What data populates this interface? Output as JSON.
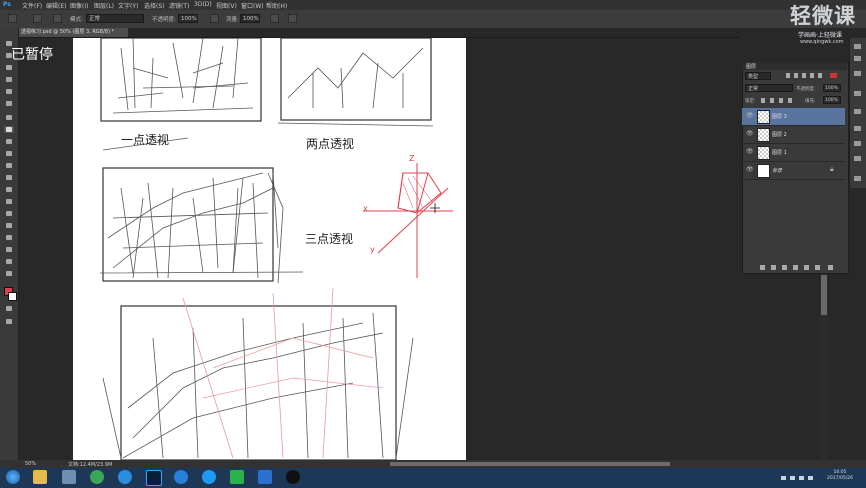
{
  "app": {
    "logo": "Ps"
  },
  "menu": [
    "文件(F)",
    "编辑(E)",
    "图像(I)",
    "图层(L)",
    "文字(Y)",
    "选择(S)",
    "滤镜(T)",
    "3D(D)",
    "视图(V)",
    "窗口(W)",
    "帮助(H)"
  ],
  "options": {
    "mode_label": "模式:",
    "mode_value": "正常",
    "opacity_label": "不透明度:",
    "opacity_value": "100%",
    "flow_label": "流量:",
    "flow_value": "100%"
  },
  "document_tab": "透视练习.psd @ 50% (图层 3, RGB/8) *",
  "overlay": {
    "paused": "已暂停"
  },
  "sketch": {
    "label_one_point": "一点透视",
    "label_two_point": "两点透视",
    "label_three_point": "三点透视",
    "axis_z": "Z",
    "axis_x": "x",
    "axis_y": "y"
  },
  "layers_panel": {
    "tab": "图层",
    "filter_label": "类型",
    "blend_mode": "正常",
    "opacity_label": "不透明度:",
    "opacity_value": "100%",
    "lock_label": "锁定:",
    "fill_label": "填充:",
    "fill_value": "100%",
    "layers": [
      {
        "name": "图层 3",
        "selected": true
      },
      {
        "name": "图层 2",
        "selected": false
      },
      {
        "name": "图层 1",
        "selected": false
      },
      {
        "name": "背景",
        "selected": false
      }
    ]
  },
  "status": {
    "zoom": "50%",
    "doc": "文档:12.4M/23.9M"
  },
  "watermark": {
    "title": "轻微课",
    "sub": "学画画·上轻微课",
    "url": "www.qingwk.com"
  },
  "clock": {
    "time": "16:05",
    "date": "2017/05/26"
  },
  "colors": {
    "accent_red": "#e0414f",
    "selected_layer": "#5a74a0",
    "panel": "#3a3a3a"
  }
}
